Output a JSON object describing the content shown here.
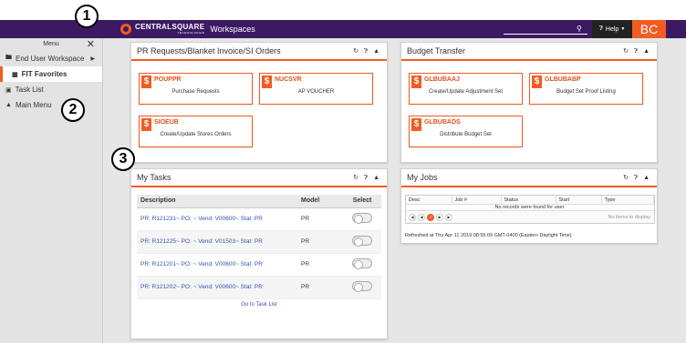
{
  "brand": {
    "name": "CENTRALSQUARE",
    "tagline": "TECHNOLOGIES",
    "app": "Workspaces"
  },
  "header": {
    "help": "Help",
    "avatar": "BC"
  },
  "callouts": [
    "1",
    "2",
    "3"
  ],
  "sidebar": {
    "title": "Menu",
    "items": [
      {
        "label": "End User Workspace",
        "icon": "folder-icon"
      },
      {
        "label": "FIT Favorites",
        "icon": "grid-icon"
      },
      {
        "label": "Task List",
        "icon": "calendar-icon"
      },
      {
        "label": "Main Menu",
        "icon": "sitemap-icon"
      }
    ]
  },
  "panels": {
    "pr": {
      "title": "PR Requests/Blanket Invoice/SI Orders",
      "tiles": [
        {
          "code": "POUPPR",
          "desc": "Purchase Requests"
        },
        {
          "code": "NUCSVR",
          "desc": "AP VOUCHER"
        },
        {
          "code": "SIOEUB",
          "desc": "Create/Update Stores Orders"
        }
      ]
    },
    "budget": {
      "title": "Budget Transfer",
      "tiles": [
        {
          "code": "GLBUBAAJ",
          "desc": "Create/Update Adjustment Set"
        },
        {
          "code": "GLBUBABP",
          "desc": "Budget Set Proof Listing"
        },
        {
          "code": "GLBUBADS",
          "desc": "Distribute Budget Set"
        }
      ]
    },
    "tasks": {
      "title": "My Tasks",
      "columns": [
        "Description",
        "Model",
        "Select"
      ],
      "rows": [
        {
          "desc": "PR: R121231~ PO: ~ Vend: V00600~ Stat: PR",
          "model": "PR"
        },
        {
          "desc": "PR: R121225~ PO: ~ Vend: V01503~ Stat: PR",
          "model": "PR"
        },
        {
          "desc": "PR: R121201~ PO: ~ Vend: V00600~ Stat: PR",
          "model": "PR"
        },
        {
          "desc": "PR: R121202~ PO: ~ Vend: V00600~ Stat: PR",
          "model": "PR"
        }
      ],
      "footer_link": "Go to Task List"
    },
    "jobs": {
      "title": "My Jobs",
      "columns": [
        "Desc",
        "Job #",
        "Status",
        "Start",
        "Type"
      ],
      "no_records": "No records were found for user.",
      "page": "0",
      "no_items": "No items to display",
      "refreshed": "Refreshed at Thu Apr 11 2019 08:55:09 GMT-0400 (Eastern Daylight Time)"
    }
  },
  "colors": {
    "accent": "#f25c22",
    "header": "#3b1a63"
  }
}
